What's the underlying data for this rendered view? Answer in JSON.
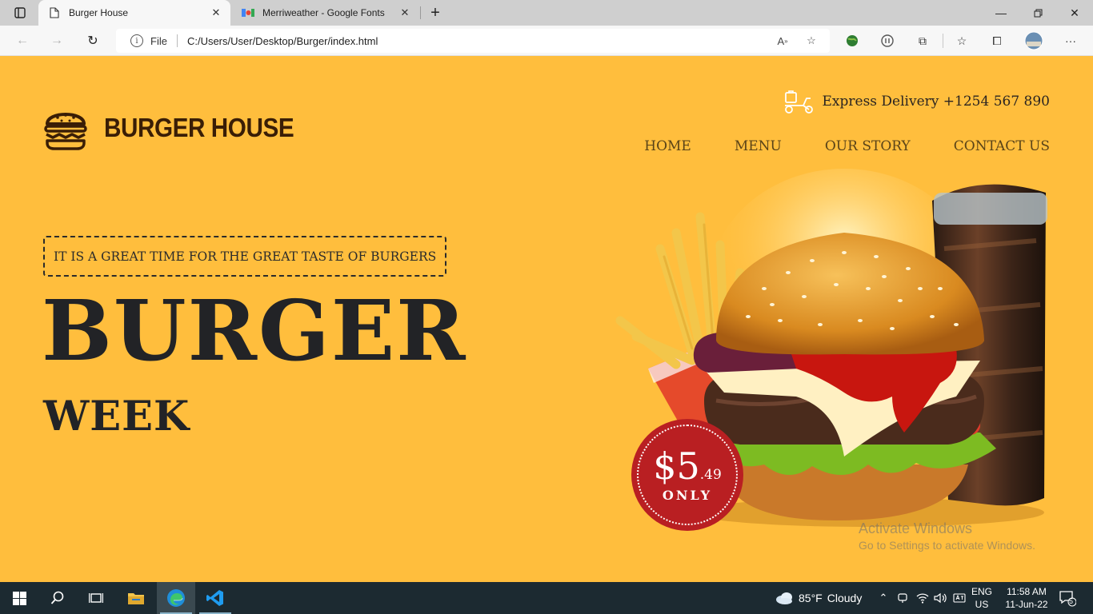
{
  "browser": {
    "tabs": [
      {
        "title": "Burger House",
        "active": true
      },
      {
        "title": "Merriweather - Google Fonts",
        "active": false
      }
    ],
    "address": {
      "scheme_label": "File",
      "url": "C:/Users/User/Desktop/Burger/index.html"
    }
  },
  "site": {
    "logo_text": "BURGER HOUSE",
    "delivery_text": "Express Delivery +1254 567 890",
    "nav": [
      "HOME",
      "MENU",
      "OUR STORY",
      "CONTACT US"
    ],
    "tagline": "IT IS A GREAT TIME FOR THE GREAT TASTE OF BURGERS",
    "hero_line1": "BURGER",
    "hero_line2": "WEEK",
    "price": {
      "currency": "$",
      "main": "5",
      "cents": ".49",
      "label": "ONLY"
    },
    "colors": {
      "background": "#ffbe3d",
      "badge": "#b91f22",
      "text": "#222326",
      "logo": "#3a1e06"
    }
  },
  "watermark": {
    "line1": "Activate Windows",
    "line2": "Go to Settings to activate Windows."
  },
  "taskbar": {
    "weather_temp": "85°F",
    "weather_desc": "Cloudy",
    "lang_top": "ENG",
    "lang_bottom": "US",
    "time": "11:58 AM",
    "date": "11-Jun-22",
    "notif_count": "5"
  }
}
